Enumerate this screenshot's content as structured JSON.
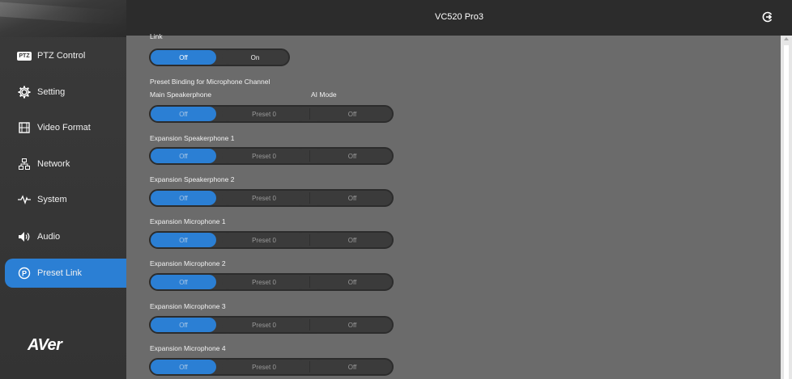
{
  "header": {
    "title": "VC520 Pro3",
    "logout_icon": "logout-icon"
  },
  "sidebar": {
    "items": [
      {
        "label": "PTZ Control",
        "icon": "ptz-icon",
        "badge": "PTZ"
      },
      {
        "label": "Setting",
        "icon": "gear-icon"
      },
      {
        "label": "Video Format",
        "icon": "film-icon"
      },
      {
        "label": "Network",
        "icon": "network-icon"
      },
      {
        "label": "System",
        "icon": "pulse-icon"
      },
      {
        "label": "Audio",
        "icon": "speaker-icon"
      },
      {
        "label": "Preset Link",
        "icon": "preset-p-icon"
      }
    ],
    "logo": "AVer",
    "accent": "#2b7fd4"
  },
  "link": {
    "label": "Link",
    "options": [
      "Off",
      "On"
    ],
    "selected": "Off"
  },
  "binding": {
    "section_label": "Preset Binding for Microphone Channel",
    "ai_mode_label": "AI Mode",
    "rows": [
      {
        "label": "Main Speakerphone",
        "link": "Off",
        "preset": "Preset 0",
        "ai": "Off"
      },
      {
        "label": "Expansion Speakerphone 1",
        "link": "Off",
        "preset": "Preset 0",
        "ai": "Off"
      },
      {
        "label": "Expansion Speakerphone 2",
        "link": "Off",
        "preset": "Preset 0",
        "ai": "Off"
      },
      {
        "label": "Expansion Microphone 1",
        "link": "Off",
        "preset": "Preset 0",
        "ai": "Off"
      },
      {
        "label": "Expansion Microphone 2",
        "link": "Off",
        "preset": "Preset 0",
        "ai": "Off"
      },
      {
        "label": "Expansion Microphone 3",
        "link": "Off",
        "preset": "Preset 0",
        "ai": "Off"
      },
      {
        "label": "Expansion Microphone 4",
        "link": "Off",
        "preset": "Preset 0",
        "ai": "Off"
      }
    ]
  }
}
